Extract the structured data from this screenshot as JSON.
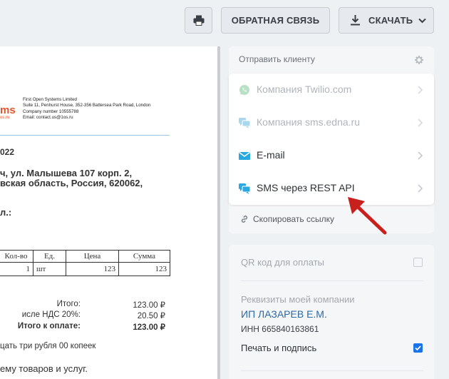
{
  "toolbar": {
    "print_icon": "printer-icon",
    "feedback_label": "ОБРАТНАЯ СВЯЗЬ",
    "download_label": "СКАЧАТЬ",
    "download_icon": "download-icon"
  },
  "document": {
    "logo_fragment": "ms",
    "logo_sub": "os.ru",
    "company_lines": [
      "First Open Systems Limited",
      "Suite 11, Penhurst House, 352-356 Battersea Park Road, London",
      "Company number 10555788",
      "Email: contact.us@1os.ru"
    ],
    "date_fragment": "022",
    "address_line1": "ч, ул. Малышева 107 корп. 2,",
    "address_line2": "вская область, Россия, 620062,",
    "recipient_fragment": "л.:",
    "table": {
      "headers": [
        "Кол-во",
        "Ед.",
        "Цена",
        "Сумма"
      ],
      "rows": [
        [
          "1",
          "шт",
          "123",
          "123"
        ]
      ]
    },
    "totals": [
      {
        "label": "Итого:",
        "value": "123.00 ₽",
        "bold": false
      },
      {
        "label": "исле НДС 20%:",
        "value": "20.50 ₽",
        "bold": false
      },
      {
        "label": "Итого к оплате:",
        "value": "123.00 ₽",
        "bold": true
      }
    ],
    "amount_words": "цать три рубля 00 копеек",
    "last_line": "ему товаров и услуг."
  },
  "send_panel": {
    "title": "Отправить клиенту",
    "items": [
      {
        "label": "Компания Twilio.com",
        "icon": "whatsapp-icon",
        "enabled": false
      },
      {
        "label": "Компания sms.edna.ru",
        "icon": "chat-bubbles-icon",
        "enabled": false
      },
      {
        "label": "E-mail",
        "icon": "envelope-icon",
        "enabled": true
      },
      {
        "label": "SMS через REST API",
        "icon": "chat-bubbles-icon",
        "enabled": true
      }
    ],
    "copy_link_label": "Скопировать ссылку"
  },
  "requisites_panel": {
    "qr_label": "QR код для оплаты",
    "qr_checked": false,
    "company_label": "Реквизиты моей компании",
    "company_name": "ИП ЛАЗАРЕВ Е.М.",
    "inn": "ИНН 665840163861",
    "sign_label": "Печать и подпись",
    "sign_checked": true
  },
  "colors": {
    "accent": "#1a73e8",
    "whatsapp": "#b8e0c4",
    "chat_enabled": "#2aa8e0",
    "chat_disabled": "#a9d8ee",
    "annotation": "#c8201c",
    "link": "#2b6aa6"
  }
}
